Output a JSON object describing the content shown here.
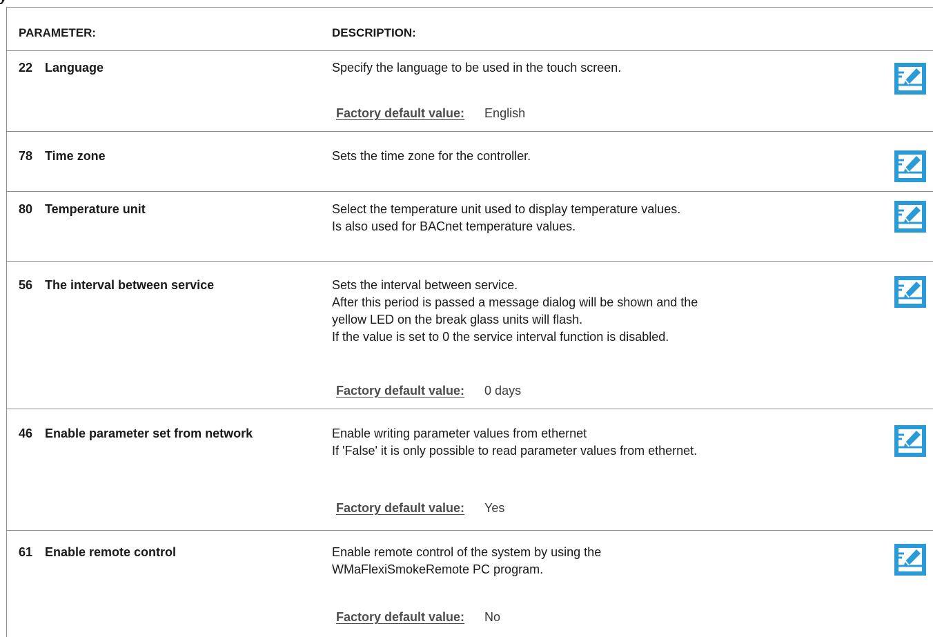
{
  "header": {
    "parameter_label": "PARAMETER:",
    "description_label": "DESCRIPTION:"
  },
  "default_label": "Factory default value:",
  "rows": [
    {
      "number": "22",
      "name": "Language",
      "description": [
        "Specify the language to be used in the touch screen."
      ],
      "default_value": "English"
    },
    {
      "number": "78",
      "name": "Time zone",
      "description": [
        "Sets the time zone for the controller."
      ],
      "default_value": null
    },
    {
      "number": "80",
      "name": "Temperature unit",
      "description": [
        "Select the temperature unit used to display temperature values.",
        "Is also used for BACnet temperature values."
      ],
      "default_value": null
    },
    {
      "number": "56",
      "name": "The interval between service",
      "description": [
        "Sets the interval between service.",
        "After this period is passed a message dialog will be shown and the",
        "yellow LED on the break glass units will flash.",
        "If the value is set to 0 the service interval function is disabled."
      ],
      "default_value": "0 days"
    },
    {
      "number": "46",
      "name": "Enable parameter set from network",
      "description": [
        "Enable writing parameter values from ethernet",
        "If 'False' it is only possible to read parameter values from ethernet."
      ],
      "default_value": "Yes"
    },
    {
      "number": "61",
      "name": "Enable remote control",
      "description": [
        "Enable remote control of the system by using the",
        "WMaFlexiSmokeRemote PC program."
      ],
      "default_value": "No"
    }
  ],
  "icons": {
    "edit": "edit-pencil-icon",
    "edit_color": "#2b9bd8"
  }
}
